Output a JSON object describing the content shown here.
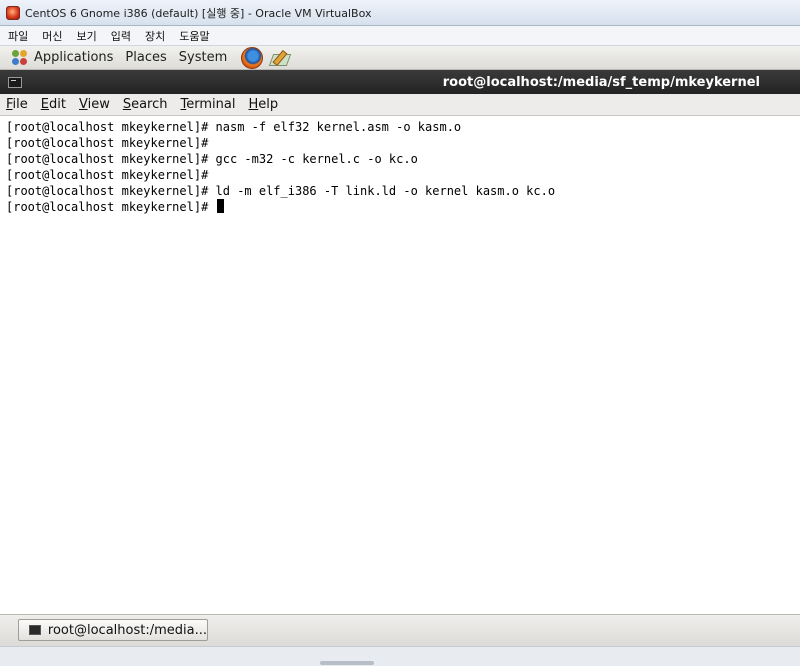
{
  "vbox": {
    "title": "CentOS 6 Gnome i386 (default) [실행 중] - Oracle VM VirtualBox",
    "menu": [
      "파일",
      "머신",
      "보기",
      "입력",
      "장치",
      "도움말"
    ]
  },
  "gnome_panel": {
    "applications": "Applications",
    "places": "Places",
    "system": "System"
  },
  "terminal": {
    "title": "root@localhost:/media/sf_temp/mkeykernel",
    "menu": [
      "File",
      "Edit",
      "View",
      "Search",
      "Terminal",
      "Help"
    ],
    "lines": [
      "[root@localhost mkeykernel]# nasm -f elf32 kernel.asm -o kasm.o",
      "[root@localhost mkeykernel]#",
      "[root@localhost mkeykernel]# gcc -m32 -c kernel.c -o kc.o",
      "[root@localhost mkeykernel]#",
      "[root@localhost mkeykernel]# ld -m elf_i386 -T link.ld -o kernel kasm.o kc.o",
      "[root@localhost mkeykernel]# "
    ]
  },
  "taskbar": {
    "task_label": "root@localhost:/media..."
  }
}
